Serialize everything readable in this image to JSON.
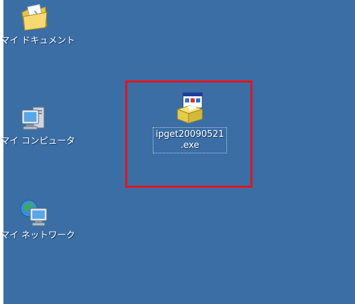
{
  "desktop": {
    "background_color": "#3a6ea5",
    "icons": [
      {
        "label": "マイ ドキュメント",
        "icon": "my-documents-folder-icon"
      },
      {
        "label": "マイ コンピュータ",
        "icon": "my-computer-icon"
      },
      {
        "label": "マイ ネットワーク",
        "icon": "my-network-icon"
      }
    ],
    "file": {
      "label_line1": "ipget20090521",
      "label_line2": ".exe",
      "icon": "installer-exe-icon"
    }
  },
  "annotation": {
    "highlight_color": "#e3141b"
  }
}
